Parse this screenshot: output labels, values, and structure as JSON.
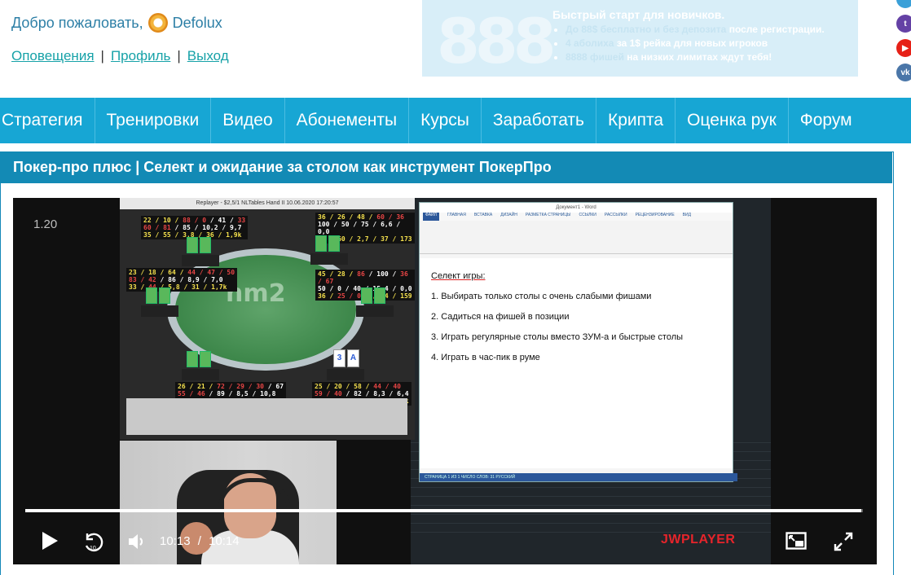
{
  "header": {
    "welcome_text": "Добро пожаловать,",
    "username": "Defolux",
    "links": {
      "notifications": "Оповещения",
      "profile": "Профиль",
      "logout": "Выход",
      "separator": "|"
    }
  },
  "banner": {
    "logo_text": "888",
    "title": "Быстрый старт для новичков.",
    "items": [
      {
        "dim": "До 88$ бесплатно и без депозита",
        "bright": " после регистрации."
      },
      {
        "dim": "4 аболиха",
        "bright": " за 1$ рейка для новых игроков"
      },
      {
        "dim": "8888 фишей",
        "bright": " на низких лимитах ждут тебя!"
      }
    ]
  },
  "nav": {
    "items": [
      "Стратегия",
      "Тренировки",
      "Видео",
      "Абонементы",
      "Курсы",
      "Заработать",
      "Крипта",
      "Оценка рук",
      "Форум"
    ]
  },
  "article": {
    "title": "Покер-про плюс | Селект и ожидание за столом как инструмент ПокерПро"
  },
  "video": {
    "overlay_time": "1.20",
    "poker_window_title": "Replayer - $2,5/1 NLTables Hand II   10.06.2020 17:20:57",
    "hm_logo": "hm2",
    "word": {
      "window_title": "Документ1 - Word",
      "tabs": [
        "ФАЙЛ",
        "ГЛАВНАЯ",
        "ВСТАВКА",
        "ДИЗАЙН",
        "РАЗМЕТКА СТРАНИЦЫ",
        "ССЫЛКИ",
        "РАССЫЛКИ",
        "РЕЦЕНЗИРОВАНИЕ",
        "ВИД"
      ],
      "heading": "Селект игры:",
      "lines": [
        "1. Выбирать только столы с очень слабыми фишами",
        "2. Садиться на фишей в позиции",
        "3. Играть регулярные столы вместо ЗУМ-а и быстрые столы",
        "4. Играть в час-пик в руме"
      ],
      "status": "СТРАНИЦА 1 ИЗ 1   ЧИСЛО СЛОВ: 31   РУССКИЙ"
    },
    "progress": 0.998,
    "current_time": "10:13",
    "time_separator": "/",
    "duration": "10:14",
    "brand": "JWPLAYER",
    "icons": [
      "play-icon",
      "rewind-10-icon",
      "volume-icon",
      "pip-icon",
      "fullscreen-icon"
    ]
  },
  "colors": {
    "nav_bg": "#17a6d4",
    "title_bar": "#138ab5",
    "link": "#17a2a8",
    "jw_red": "#e6242b"
  }
}
